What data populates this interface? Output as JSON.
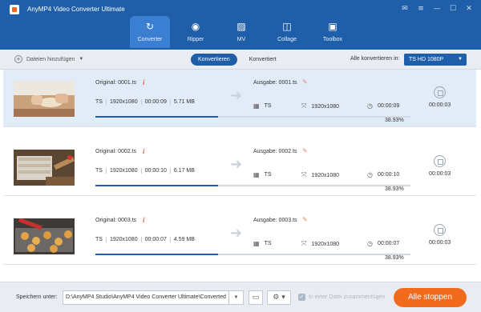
{
  "app": {
    "title": "AnyMP4 Video Converter Ultimate"
  },
  "window_controls": [
    "✉",
    "≡",
    "—",
    "☐",
    "✕"
  ],
  "nav": [
    {
      "label": "Converter",
      "icon": "convert-icon",
      "glyph": "↻",
      "active": true
    },
    {
      "label": "Ripper",
      "icon": "disc-icon",
      "glyph": "◉",
      "active": false
    },
    {
      "label": "MV",
      "icon": "image-icon",
      "glyph": "▨",
      "active": false
    },
    {
      "label": "Collage",
      "icon": "collage-icon",
      "glyph": "◫",
      "active": false
    },
    {
      "label": "Toolbox",
      "icon": "toolbox-icon",
      "glyph": "▣",
      "active": false
    }
  ],
  "toolbar": {
    "add_files": "Dateien hinzufügen",
    "tab_converting": "Konvertieren",
    "tab_converted": "Konvertiert",
    "convert_all_label": "Alle konvertieren in:",
    "format": "TS HD 1080P"
  },
  "files": [
    {
      "original_label": "Original:",
      "original_name": "0001.ts",
      "src_format": "TS",
      "src_resolution": "1920x1080",
      "src_duration": "00:00:09",
      "src_size": "5.71 MB",
      "output_label": "Ausgabe:",
      "output_name": "0001.ts",
      "dst_format": "TS",
      "dst_resolution": "1920x1080",
      "dst_duration": "00:00:09",
      "progress_text": "38.93%",
      "progress": 0.3893,
      "elapsed": "00:00:03"
    },
    {
      "original_label": "Original:",
      "original_name": "0002.ts",
      "src_format": "TS",
      "src_resolution": "1920x1080",
      "src_duration": "00:00:10",
      "src_size": "6.17 MB",
      "output_label": "Ausgabe:",
      "output_name": "0002.ts",
      "dst_format": "TS",
      "dst_resolution": "1920x1080",
      "dst_duration": "00:00:10",
      "progress_text": "38.93%",
      "progress": 0.3893,
      "elapsed": "00:00:03"
    },
    {
      "original_label": "Original:",
      "original_name": "0003.ts",
      "src_format": "TS",
      "src_resolution": "1920x1080",
      "src_duration": "00:00:07",
      "src_size": "4.59 MB",
      "output_label": "Ausgabe:",
      "output_name": "0003.ts",
      "dst_format": "TS",
      "dst_resolution": "1920x1080",
      "dst_duration": "00:00:07",
      "progress_text": "38.93%",
      "progress": 0.3893,
      "elapsed": "00:00:03"
    }
  ],
  "footer": {
    "save_label": "Speichern unter:",
    "save_path": "D:\\AnyMP4 Studio\\AnyMP4 Video Converter Ultimate\\Converted",
    "merge_label": "In einer Datei zusammenfügen",
    "stop_all": "Alle stoppen"
  },
  "colors": {
    "brand": "#1f5ea8",
    "accent": "#f26b1d",
    "active_tab": "#3a7fd2"
  }
}
